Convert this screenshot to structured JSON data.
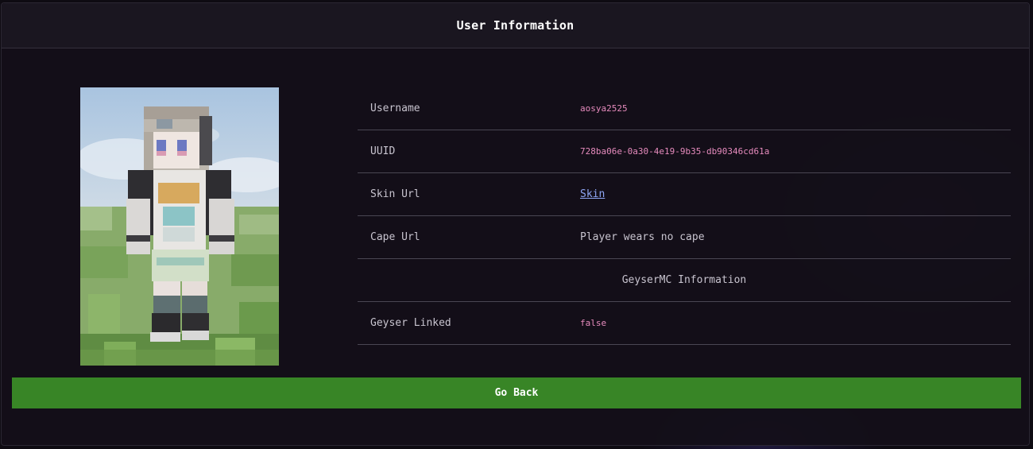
{
  "header": {
    "title": "User Information"
  },
  "profile": {
    "rows": {
      "username": {
        "label": "Username",
        "value": "aosya2525"
      },
      "uuid": {
        "label": "UUID",
        "value": "728ba06e-0a30-4e19-9b35-db90346cd61a"
      },
      "skin_url": {
        "label": "Skin Url",
        "value": "Skin"
      },
      "cape_url": {
        "label": "Cape Url",
        "value": "Player wears no cape"
      }
    },
    "geyser_section_title": "GeyserMC Information",
    "geyser_linked": {
      "label": "Geyser Linked",
      "value": "false"
    }
  },
  "actions": {
    "go_back_label": "Go Back"
  },
  "colors": {
    "accent_button": "#388526",
    "code_value": "#e68bbd",
    "link": "#8ea6f4"
  }
}
